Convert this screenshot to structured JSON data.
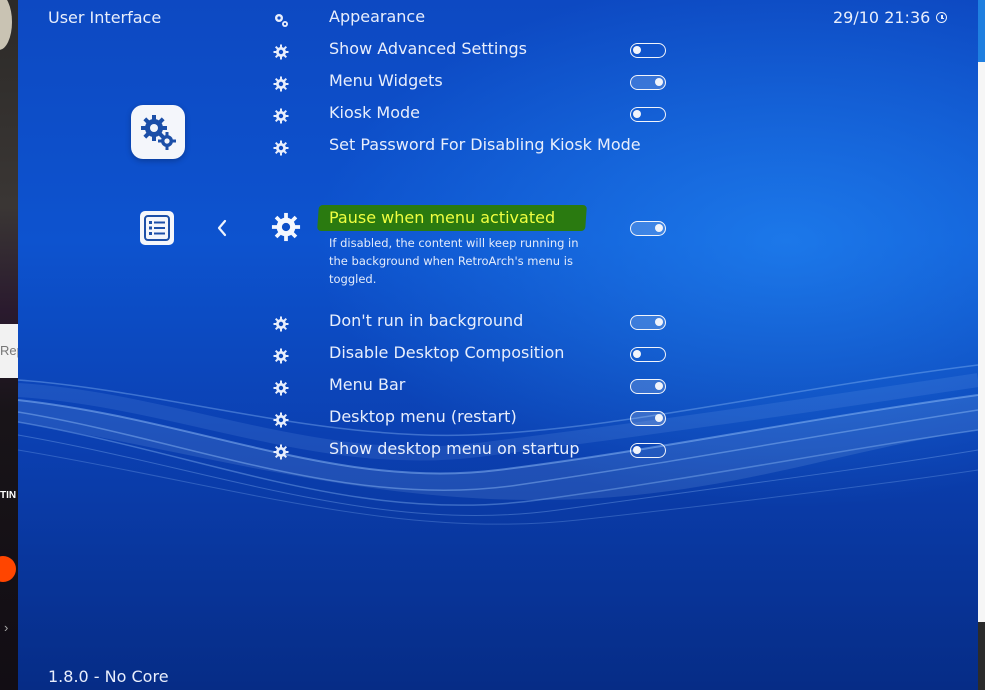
{
  "header": {
    "title": "User Interface",
    "datetime": "29/10 21:36"
  },
  "footer": {
    "version": "1.8.0 - No Core"
  },
  "menu": {
    "items_above": [
      {
        "label": "Appearance",
        "toggle": null
      },
      {
        "label": "Show Advanced Settings",
        "toggle": "off"
      },
      {
        "label": "Menu Widgets",
        "toggle": "on"
      },
      {
        "label": "Kiosk Mode",
        "toggle": "off"
      },
      {
        "label": "Set Password For Disabling Kiosk Mode",
        "toggle": null
      }
    ],
    "active": {
      "label": "Pause when menu activated",
      "description": "If disabled, the content will keep running in the background when RetroArch's menu is toggled.",
      "toggle": "on"
    },
    "items_below": [
      {
        "label": "Don't run in background",
        "toggle": "on"
      },
      {
        "label": "Disable Desktop Composition",
        "toggle": "off"
      },
      {
        "label": "Menu Bar",
        "toggle": "on"
      },
      {
        "label": "Desktop menu (restart)",
        "toggle": "on"
      },
      {
        "label": "Show desktop menu on startup",
        "toggle": "off"
      }
    ]
  },
  "background_windows": {
    "input_fragment": "Rep",
    "label_fragment": "TIN"
  },
  "colors": {
    "accent_highlight": "#2a7a10",
    "highlight_text": "#f0ff40",
    "background_top": "#0d49c2"
  }
}
